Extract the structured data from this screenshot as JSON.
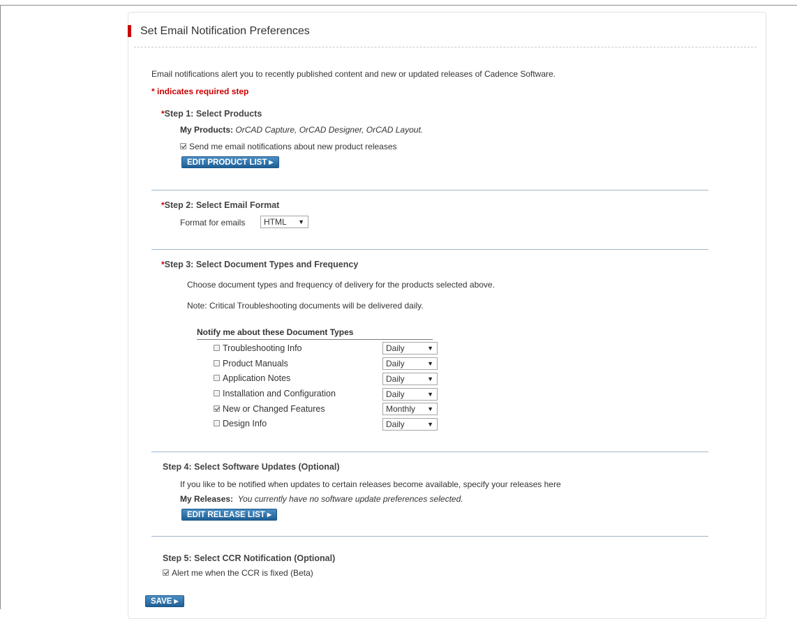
{
  "title": "Set Email Notification Preferences",
  "intro": "Email notifications alert you to recently published content and new or updated releases of Cadence Software.",
  "required_note": "* indicates required step",
  "step1": {
    "star": "*",
    "title": "Step 1: Select Products",
    "my_products_label": "My Products:",
    "my_products_value": "OrCAD Capture, OrCAD Designer, OrCAD Layout.",
    "checkbox_label": "Send me email notifications about new product releases",
    "checkbox_checked": true,
    "button_label": "EDIT PRODUCT LIST"
  },
  "step2": {
    "star": "*",
    "title": "Step 2: Select Email Format",
    "format_label": "Format for emails",
    "format_value": "HTML"
  },
  "step3": {
    "star": "*",
    "title": "Step 3: Select Document Types and Frequency",
    "description": "Choose document types and frequency of delivery for the products selected above.",
    "note": "Note: Critical Troubleshooting documents will be delivered daily.",
    "table_header": "Notify me about these Document Types",
    "doc_types": [
      {
        "label": "Troubleshooting Info",
        "checked": false,
        "frequency": "Daily"
      },
      {
        "label": "Product Manuals",
        "checked": false,
        "frequency": "Daily"
      },
      {
        "label": "Application Notes",
        "checked": false,
        "frequency": "Daily"
      },
      {
        "label": "Installation and Configuration",
        "checked": false,
        "frequency": "Daily"
      },
      {
        "label": "New or Changed Features",
        "checked": true,
        "frequency": "Monthly"
      },
      {
        "label": "Design Info",
        "checked": false,
        "frequency": "Daily"
      }
    ]
  },
  "step4": {
    "title": "Step 4: Select Software Updates (Optional)",
    "description": "If you like to be notified when updates to certain releases become available, specify your releases here",
    "my_releases_label": "My Releases:",
    "my_releases_value": "You currently have no software update preferences selected.",
    "button_label": "EDIT RELEASE LIST"
  },
  "step5": {
    "title": "Step 5: Select CCR Notification (Optional)",
    "checkbox_label": "Alert me when the CCR is fixed (Beta)",
    "checkbox_checked": true
  },
  "save_label": "SAVE",
  "icons": {
    "button_arrow": "triangle-right-icon",
    "select_caret": "caret-down-icon"
  },
  "colors": {
    "accent_red": "#cc0000",
    "button_blue": "#2a6ea8",
    "separator": "#9fb6cc"
  }
}
